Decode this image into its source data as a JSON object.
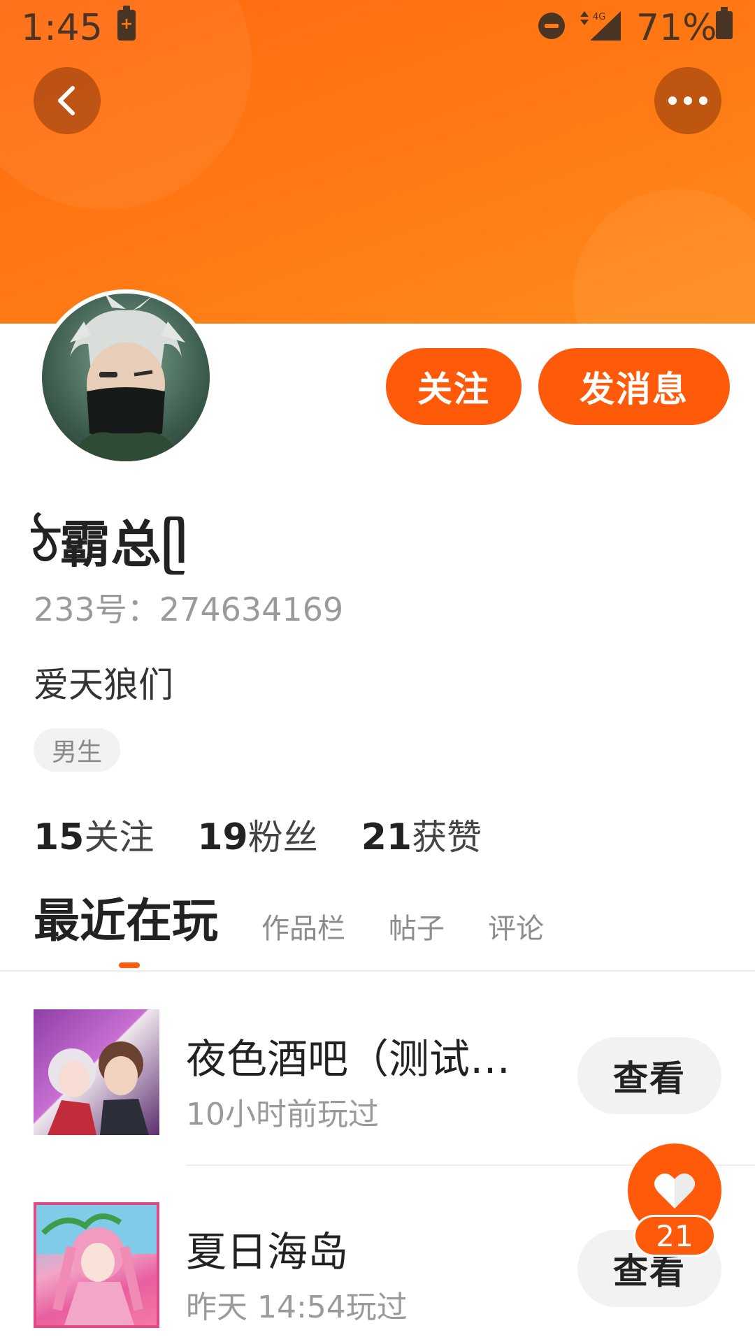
{
  "status_bar": {
    "time": "1:45",
    "network": "4G",
    "battery": "71%"
  },
  "colors": {
    "accent": "#ff5a0a",
    "banner": "#ff7a14",
    "text_primary": "#222222",
    "text_secondary": "#9a9a9a"
  },
  "header": {
    "back_icon": "chevron-left-icon",
    "more_icon": "more-horizontal-icon"
  },
  "profile": {
    "follow_label": "关注",
    "message_label": "发消息",
    "name": "ঠ霸总ᥫ",
    "id_text": "233号：274634169",
    "bio": "爱天狼们",
    "gender_tag": "男生",
    "stats": [
      {
        "num": "15",
        "label": "关注"
      },
      {
        "num": "19",
        "label": "粉丝"
      },
      {
        "num": "21",
        "label": "获赞"
      }
    ]
  },
  "tabs": [
    {
      "label": "最近在玩",
      "active": true
    },
    {
      "label": "作品栏",
      "active": false
    },
    {
      "label": "帖子",
      "active": false
    },
    {
      "label": "评论",
      "active": false
    }
  ],
  "games": [
    {
      "title": "夜色酒吧（测试…",
      "played": "10小时前玩过",
      "action": "查看"
    },
    {
      "title": "夏日海岛",
      "played": "昨天 14:54玩过",
      "action": "查看"
    }
  ],
  "like_fab": {
    "icon": "heart-icon",
    "count": "21"
  }
}
